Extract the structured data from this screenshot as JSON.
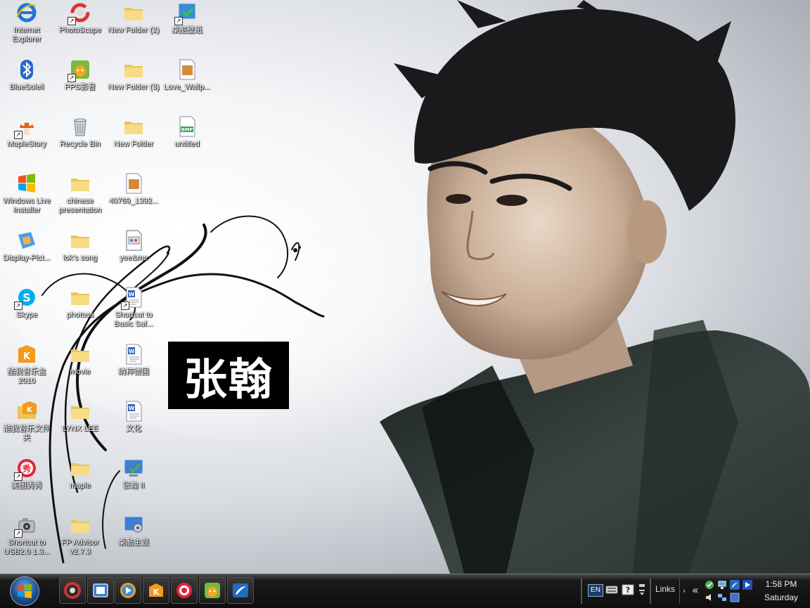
{
  "wallpaper": {
    "sign_text": "张翰"
  },
  "desktop_icons": [
    {
      "label": "Internet Explorer",
      "icon": "internet-explorer-icon",
      "shortcut": false
    },
    {
      "label": "PhotoScape",
      "icon": "photoscape-icon",
      "shortcut": true
    },
    {
      "label": "New Folder (2)",
      "icon": "folder-icon",
      "shortcut": false
    },
    {
      "label": "桌酷壁紙",
      "icon": "wallpaper-app-icon",
      "shortcut": true
    },
    {
      "label": "BlueSoleil",
      "icon": "bluetooth-icon",
      "shortcut": false
    },
    {
      "label": "PPS影音",
      "icon": "pps-icon",
      "shortcut": true
    },
    {
      "label": "New Folder (3)",
      "icon": "folder-icon",
      "shortcut": false
    },
    {
      "label": "Love_Wallp...",
      "icon": "image-file-icon",
      "shortcut": false
    },
    {
      "label": "MapleStory",
      "icon": "maplestory-icon",
      "shortcut": true
    },
    {
      "label": "Recycle Bin",
      "icon": "recycle-bin-icon",
      "shortcut": false
    },
    {
      "label": "New Folder",
      "icon": "folder-icon",
      "shortcut": false
    },
    {
      "label": "untitled",
      "icon": "bmp-file-icon",
      "shortcut": false
    },
    {
      "label": "Windows Live Installer",
      "icon": "windows-live-icon",
      "shortcut": false
    },
    {
      "label": "chinese presentation",
      "icon": "folder-icon",
      "shortcut": false
    },
    {
      "label": "40769_1392...",
      "icon": "image-file-icon",
      "shortcut": false
    },
    {
      "label": "Display-Pict...",
      "icon": "display-picture-icon",
      "shortcut": false
    },
    {
      "label": "lok's song",
      "icon": "folder-icon",
      "shortcut": false
    },
    {
      "label": "yee&me",
      "icon": "text-file-icon",
      "shortcut": false
    },
    {
      "label": "Skype",
      "icon": "skype-icon",
      "shortcut": true
    },
    {
      "label": "photoss",
      "icon": "folder-icon",
      "shortcut": false
    },
    {
      "label": "Shortcut to Basic Saf...",
      "icon": "word-document-icon",
      "shortcut": true
    },
    {
      "label": "酷我音乐盒 2010",
      "icon": "kuwo-music-icon",
      "shortcut": false
    },
    {
      "label": "movie",
      "icon": "folder-icon",
      "shortcut": false
    },
    {
      "label": "纳粹德国",
      "icon": "word-document-icon",
      "shortcut": false
    },
    {
      "label": "酷我音乐文件夹",
      "icon": "kuwo-folder-icon",
      "shortcut": false
    },
    {
      "label": "LYNX LEE",
      "icon": "folder-icon",
      "shortcut": false
    },
    {
      "label": "文化",
      "icon": "word-document-icon",
      "shortcut": false
    },
    {
      "label": "美图秀秀",
      "icon": "meitu-icon",
      "shortcut": true
    },
    {
      "label": "maple",
      "icon": "folder-icon",
      "shortcut": false
    },
    {
      "label": "张翰 II",
      "icon": "theme-icon",
      "shortcut": false
    },
    {
      "label": "Shortcut to USB2.0 1.3...",
      "icon": "usb-camera-icon",
      "shortcut": true
    },
    {
      "label": "FP Advisor v2.7.3",
      "icon": "folder-icon",
      "shortcut": false
    },
    {
      "label": "桌酷主题",
      "icon": "theme-settings-icon",
      "shortcut": false
    }
  ],
  "taskbar": {
    "quick_launch": [
      {
        "name": "photoscape-launch-icon"
      },
      {
        "name": "desktop-switch-icon"
      },
      {
        "name": "media-player-icon"
      },
      {
        "name": "kuwo-launch-icon"
      },
      {
        "name": "meitu-launch-icon"
      },
      {
        "name": "pps-launch-icon"
      },
      {
        "name": "feather-launch-icon"
      }
    ],
    "language": "EN",
    "links_label": "Links",
    "clock": {
      "time": "1:58 PM",
      "day": "Saturday"
    }
  }
}
